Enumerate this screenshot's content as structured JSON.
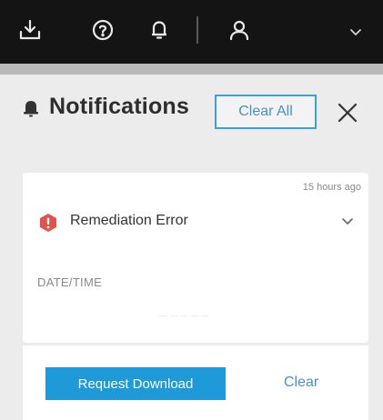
{
  "topbar": {
    "icons": [
      "download-icon",
      "help-icon",
      "bell-icon",
      "user-icon",
      "chevron-down-icon"
    ]
  },
  "panel": {
    "title": "Notifications",
    "clear_all_label": "Clear All",
    "close_icon": "close-icon"
  },
  "notification": {
    "time": "15 hours ago",
    "title": "Remediation Error",
    "status_icon": "error-icon",
    "status_color": "#e0534a",
    "datetime_label": "DATE/TIME",
    "datetime_value": "— — — — —"
  },
  "actions": {
    "request_download_label": "Request Download",
    "clear_label": "Clear"
  },
  "colors": {
    "accent": "#1f9ad8",
    "topbar": "#141414"
  }
}
